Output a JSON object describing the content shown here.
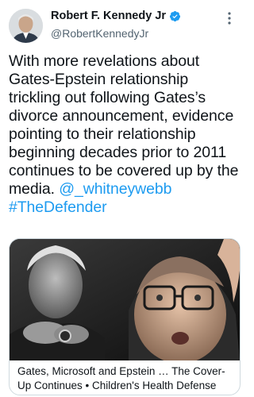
{
  "author": {
    "display_name": "Robert F. Kennedy Jr",
    "handle": "@RobertKennedyJr",
    "verified": true
  },
  "tweet": {
    "text": "With more revelations about Gates-Epstein relationship trickling out following Gates’s divorce announcement, evidence pointing to their relationship beginning decades prior to 2011 continues to be covered up by the media.",
    "mention": "@_whitneywebb",
    "hashtag": "#TheDefender"
  },
  "link_card": {
    "title": "Gates, Microsoft and Epstein … The Cover-Up Continues • Children's Health Defense"
  },
  "icons": {
    "verified": "verified-badge-icon",
    "more": "more-options-icon"
  },
  "colors": {
    "link": "#1d9bf0",
    "text": "#0f1419",
    "secondary": "#536471",
    "border": "#cfd9de"
  }
}
